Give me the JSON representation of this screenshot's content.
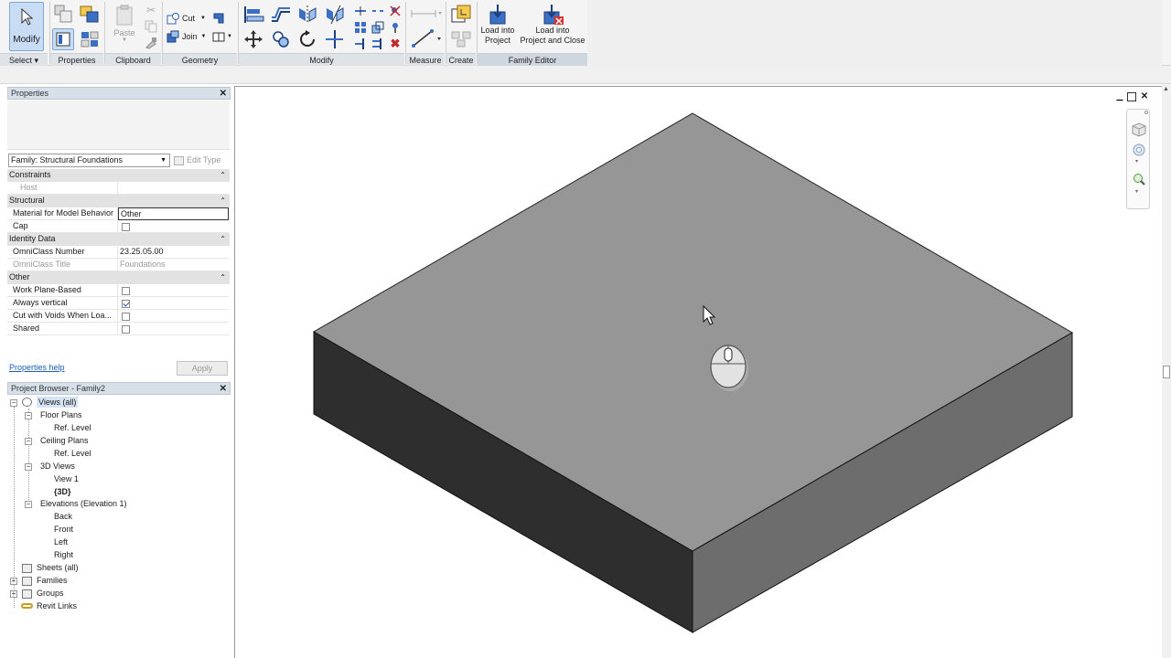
{
  "ribbon": {
    "select": {
      "modify_label": "Modify",
      "panel_label": "Select ▾"
    },
    "properties": {
      "panel_label": "Properties"
    },
    "clipboard": {
      "paste_label": "Paste",
      "panel_label": "Clipboard"
    },
    "geometry": {
      "cut_label": "Cut",
      "join_label": "Join",
      "panel_label": "Geometry"
    },
    "modify": {
      "panel_label": "Modify"
    },
    "measure": {
      "panel_label": "Measure"
    },
    "create": {
      "panel_label": "Create"
    },
    "family_editor": {
      "load_line1": "Load into",
      "load_line2": "Project",
      "load_close_line1": "Load into",
      "load_close_line2": "Project and Close",
      "panel_label": "Family Editor"
    }
  },
  "properties_palette": {
    "title": "Properties",
    "type_selector": "Family: Structural Foundations",
    "edit_type_label": "Edit Type",
    "groups": [
      {
        "name": "Constraints",
        "rows": [
          {
            "name": "Host",
            "value": "",
            "disabled": true
          }
        ]
      },
      {
        "name": "Structural",
        "rows": [
          {
            "name": "Material for Model Behavior",
            "value": "Other"
          },
          {
            "name": "Cap",
            "check": false
          }
        ]
      },
      {
        "name": "Identity Data",
        "rows": [
          {
            "name": "OmniClass Number",
            "value": "23.25.05.00"
          },
          {
            "name": "OmniClass Title",
            "value": "Foundations",
            "disabled": true
          }
        ]
      },
      {
        "name": "Other",
        "rows": [
          {
            "name": "Work Plane-Based",
            "check": false
          },
          {
            "name": "Always vertical",
            "check": true
          },
          {
            "name": "Cut with Voids When Loa...",
            "check": false
          },
          {
            "name": "Shared",
            "check": false
          }
        ]
      }
    ],
    "help_link": "Properties help",
    "apply_label": "Apply"
  },
  "project_browser": {
    "title": "Project Browser - Family2",
    "views_all": "Views (all)",
    "floor_plans": "Floor Plans",
    "floor_ref": "Ref. Level",
    "ceiling_plans": "Ceiling Plans",
    "ceiling_ref": "Ref. Level",
    "views_3d": "3D Views",
    "view1": "View 1",
    "view_3d": "{3D}",
    "elevations": "Elevations (Elevation 1)",
    "back": "Back",
    "front": "Front",
    "left": "Left",
    "right": "Right",
    "sheets": "Sheets (all)",
    "families": "Families",
    "groups": "Groups",
    "revit_links": "Revit Links"
  },
  "colors": {
    "top_face": "#969696",
    "left_face": "#2e2e2e",
    "right_face": "#6d6d6d",
    "accent": "#1f5fb5"
  }
}
